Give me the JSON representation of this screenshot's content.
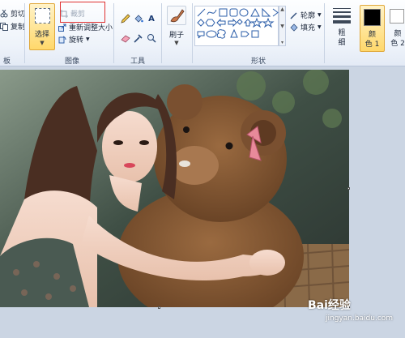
{
  "clipboard": {
    "cut_label": "剪切",
    "copy_label": "复制",
    "group_label": "板"
  },
  "image": {
    "select_label": "选择",
    "crop_label": "裁剪",
    "resize_label": "重新调整大小",
    "rotate_label": "旋转",
    "group_label": "图像"
  },
  "tools": {
    "text_tool_label": "A",
    "group_label": "工具"
  },
  "brush": {
    "label": "刷子"
  },
  "shapes": {
    "outline_label": "轮廓",
    "fill_label": "填充",
    "group_label": "形状"
  },
  "size": {
    "label_line1": "粗",
    "label_line2": "细"
  },
  "colors": {
    "color1_line1": "颜",
    "color1_line2": "色 1",
    "color2_line1": "颜",
    "color2_line2": "色 2",
    "color1_value": "#000000",
    "color2_value": "#ffffff",
    "accent": "#ffd86b",
    "highlight": "#e03030"
  },
  "watermark": {
    "brand": "Bai经验",
    "url": "jingyan.baidu.com"
  },
  "icons": [
    "scissors-icon",
    "copy-icon",
    "crop-icon",
    "resize-icon",
    "rotate-icon",
    "pencil-icon",
    "fill-bucket-icon",
    "text-icon",
    "eraser-icon",
    "color-picker-icon",
    "magnifier-icon",
    "brush-icon",
    "shapes-gallery",
    "size-icon"
  ]
}
